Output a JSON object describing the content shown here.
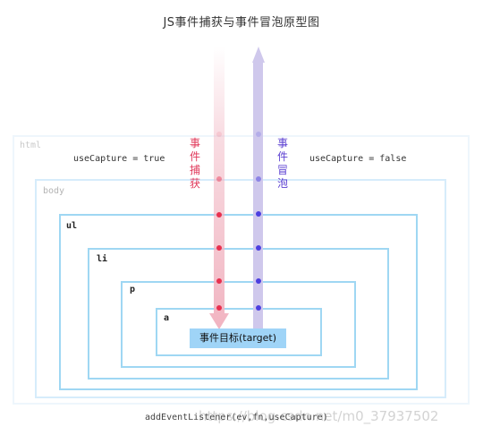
{
  "diagram": {
    "title": "JS事件捕获与事件冒泡原型图",
    "boxes": {
      "html": "html",
      "body": "body",
      "ul": "ul",
      "li": "li",
      "p": "p",
      "a": "a"
    },
    "capture_true_label": "useCapture = true",
    "capture_false_label": "useCapture = false",
    "capture_arrow_label": "事件捕获",
    "bubble_arrow_label": "事件冒泡",
    "target_label": "事件目标(target)",
    "listener_signature": "addEventListener(ev,fn,useCapture)",
    "watermark": "https://blog.csdn.net/m0_37937502"
  },
  "colors": {
    "capture_arrow": "#f1b4c1",
    "capture_dot": "#e8304f",
    "bubble_arrow": "#cfc8ec",
    "bubble_dot": "#4c3fe0",
    "box_border": "#9fd7f3",
    "target_fill": "#9fd4f7"
  }
}
